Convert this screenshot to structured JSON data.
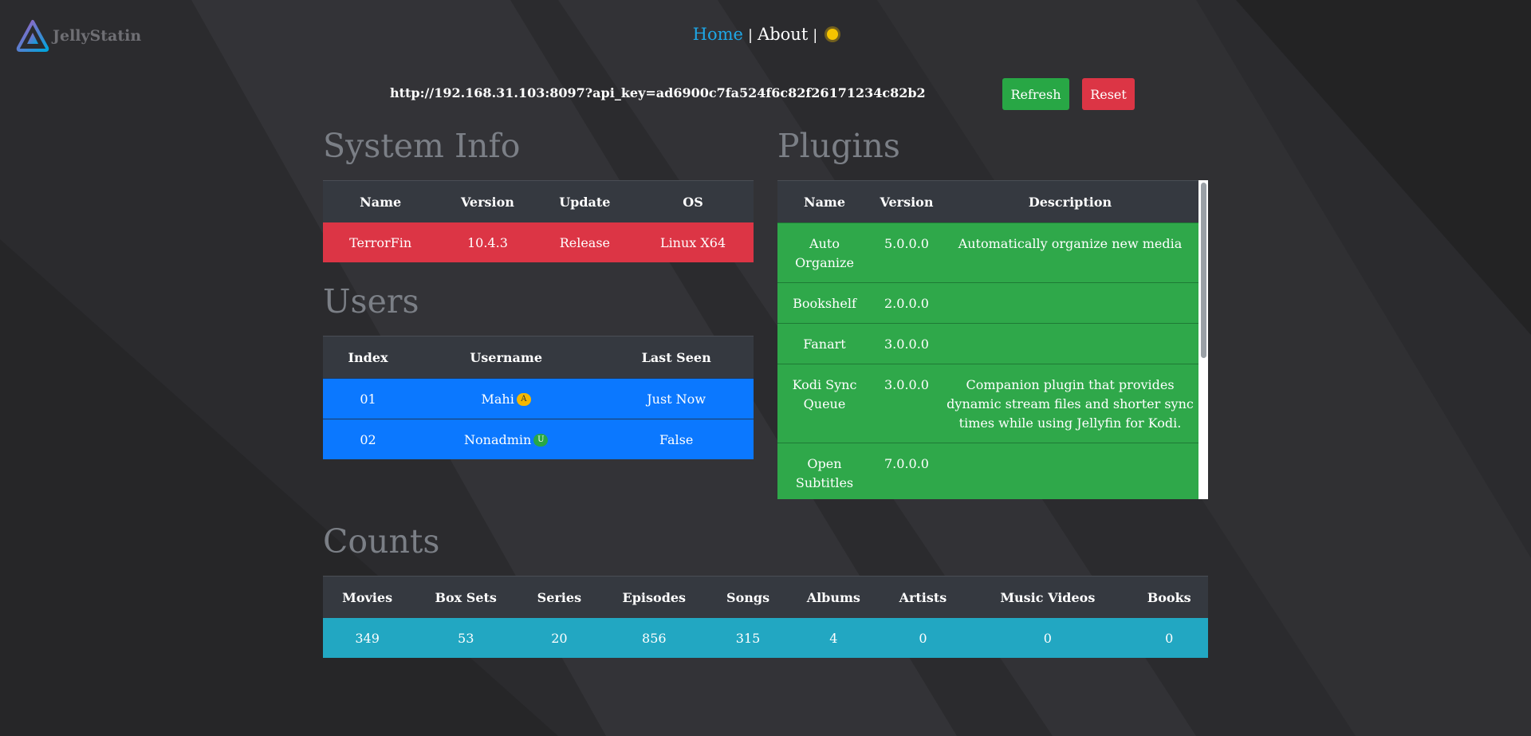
{
  "app": {
    "name": "JellyStatin"
  },
  "nav": {
    "home": "Home",
    "about": "About",
    "sep": "|"
  },
  "connection": {
    "url": "http://192.168.31.103:8097?api_key=ad6900c7fa524f6c82f26171234c82b2"
  },
  "actions": {
    "refresh": "Refresh",
    "reset": "Reset"
  },
  "system_info": {
    "title": "System Info",
    "headers": [
      "Name",
      "Version",
      "Update",
      "OS"
    ],
    "row": [
      "TerrorFin",
      "10.4.3",
      "Release",
      "Linux X64"
    ]
  },
  "users": {
    "title": "Users",
    "headers": [
      "Index",
      "Username",
      "Last Seen"
    ],
    "rows": [
      {
        "index": "01",
        "username": "Mahi",
        "badge": "A",
        "last_seen": "Just Now"
      },
      {
        "index": "02",
        "username": "Nonadmin",
        "badge": "U",
        "last_seen": "False"
      }
    ]
  },
  "plugins": {
    "title": "Plugins",
    "headers": [
      "Name",
      "Version",
      "Description"
    ],
    "rows": [
      {
        "name": "Auto Organize",
        "version": "5.0.0.0",
        "description": "Automatically organize new media"
      },
      {
        "name": "Bookshelf",
        "version": "2.0.0.0",
        "description": ""
      },
      {
        "name": "Fanart",
        "version": "3.0.0.0",
        "description": ""
      },
      {
        "name": "Kodi Sync Queue",
        "version": "3.0.0.0",
        "description": "Companion plugin that provides dynamic stream files and shorter sync times while using Jellyfin for Kodi."
      },
      {
        "name": "Open Subtitles",
        "version": "7.0.0.0",
        "description": ""
      }
    ]
  },
  "counts": {
    "title": "Counts",
    "headers": [
      "Movies",
      "Box Sets",
      "Series",
      "Episodes",
      "Songs",
      "Albums",
      "Artists",
      "Music Videos",
      "Books"
    ],
    "values": [
      "349",
      "53",
      "20",
      "856",
      "315",
      "4",
      "0",
      "0",
      "0"
    ]
  },
  "colors": {
    "accent": "#1ea7e6",
    "refresh": "#28a745",
    "reset": "#dc3545",
    "system_row": "#dc3545",
    "users_row": "#0b78ff",
    "plugins_row": "#2fa84a",
    "counts_row": "#22a7c2"
  },
  "icons": {
    "logo": "jellyfin-logo-icon",
    "theme": "sun-icon"
  }
}
